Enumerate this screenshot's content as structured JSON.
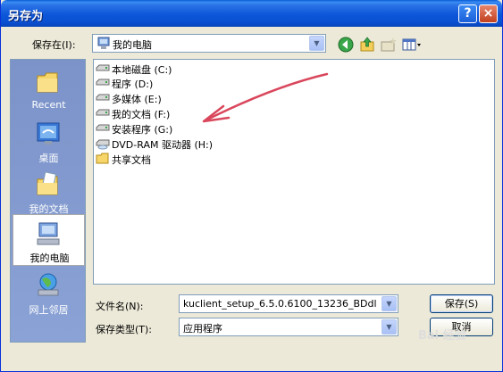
{
  "title": "另存为",
  "titlebar_buttons": {
    "help": "?",
    "close": "×"
  },
  "save_in": {
    "label": "保存在(I):",
    "value": "我的电脑"
  },
  "places": [
    {
      "label": "Recent",
      "icon": "recent-folder-icon",
      "selected": false
    },
    {
      "label": "桌面",
      "icon": "desktop-icon",
      "selected": false
    },
    {
      "label": "我的文档",
      "icon": "my-documents-icon",
      "selected": false
    },
    {
      "label": "我的电脑",
      "icon": "my-computer-icon",
      "selected": true
    },
    {
      "label": "网上邻居",
      "icon": "network-places-icon",
      "selected": false
    }
  ],
  "items": [
    {
      "name": "本地磁盘 (C:)",
      "icon": "drive-icon"
    },
    {
      "name": "程序 (D:)",
      "icon": "drive-icon"
    },
    {
      "name": "多媒体 (E:)",
      "icon": "drive-icon"
    },
    {
      "name": "我的文档 (F:)",
      "icon": "drive-icon"
    },
    {
      "name": "安装程序 (G:)",
      "icon": "drive-icon"
    },
    {
      "name": "DVD-RAM 驱动器 (H:)",
      "icon": "dvd-drive-icon"
    },
    {
      "name": "共享文档",
      "icon": "folder-icon"
    }
  ],
  "filename": {
    "label": "文件名(N):",
    "value": "kuclient_setup_6.5.0.6100_13236_BDdl"
  },
  "filetype": {
    "label": "保存类型(T):",
    "value": "应用程序"
  },
  "buttons": {
    "save": "保存(S)",
    "cancel": "取消"
  },
  "watermark": "Bai 经验",
  "colors": {
    "titlebar": "#0a4fd0",
    "dialog_bg": "#ece9d8",
    "annotation_arrow": "#d9475c"
  }
}
